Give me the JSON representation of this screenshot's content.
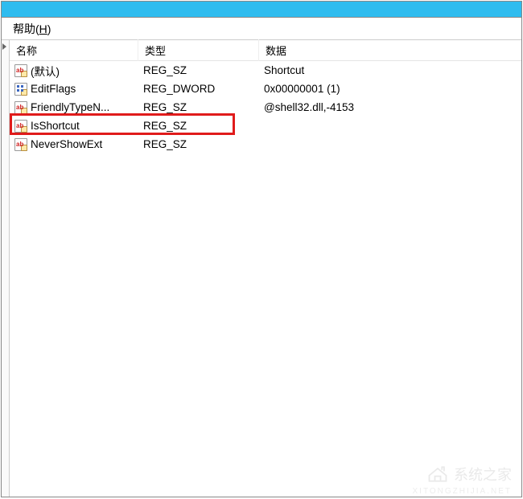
{
  "menu": {
    "help_label": "帮助",
    "help_accel": "H"
  },
  "columns": {
    "name": "名称",
    "type": "类型",
    "data": "数据"
  },
  "rows": [
    {
      "icon": "sz",
      "name": "(默认)",
      "type": "REG_SZ",
      "data": "Shortcut"
    },
    {
      "icon": "dw",
      "name": "EditFlags",
      "type": "REG_DWORD",
      "data": "0x00000001 (1)"
    },
    {
      "icon": "sz",
      "name": "FriendlyTypeN...",
      "type": "REG_SZ",
      "data": "@shell32.dll,-4153"
    },
    {
      "icon": "sz",
      "name": "IsShortcut",
      "type": "REG_SZ",
      "data": ""
    },
    {
      "icon": "sz",
      "name": "NeverShowExt",
      "type": "REG_SZ",
      "data": ""
    }
  ],
  "highlight_row_index": 3,
  "watermark": {
    "text": "系统之家",
    "sub": "XITONGZHIJIA.NET"
  }
}
